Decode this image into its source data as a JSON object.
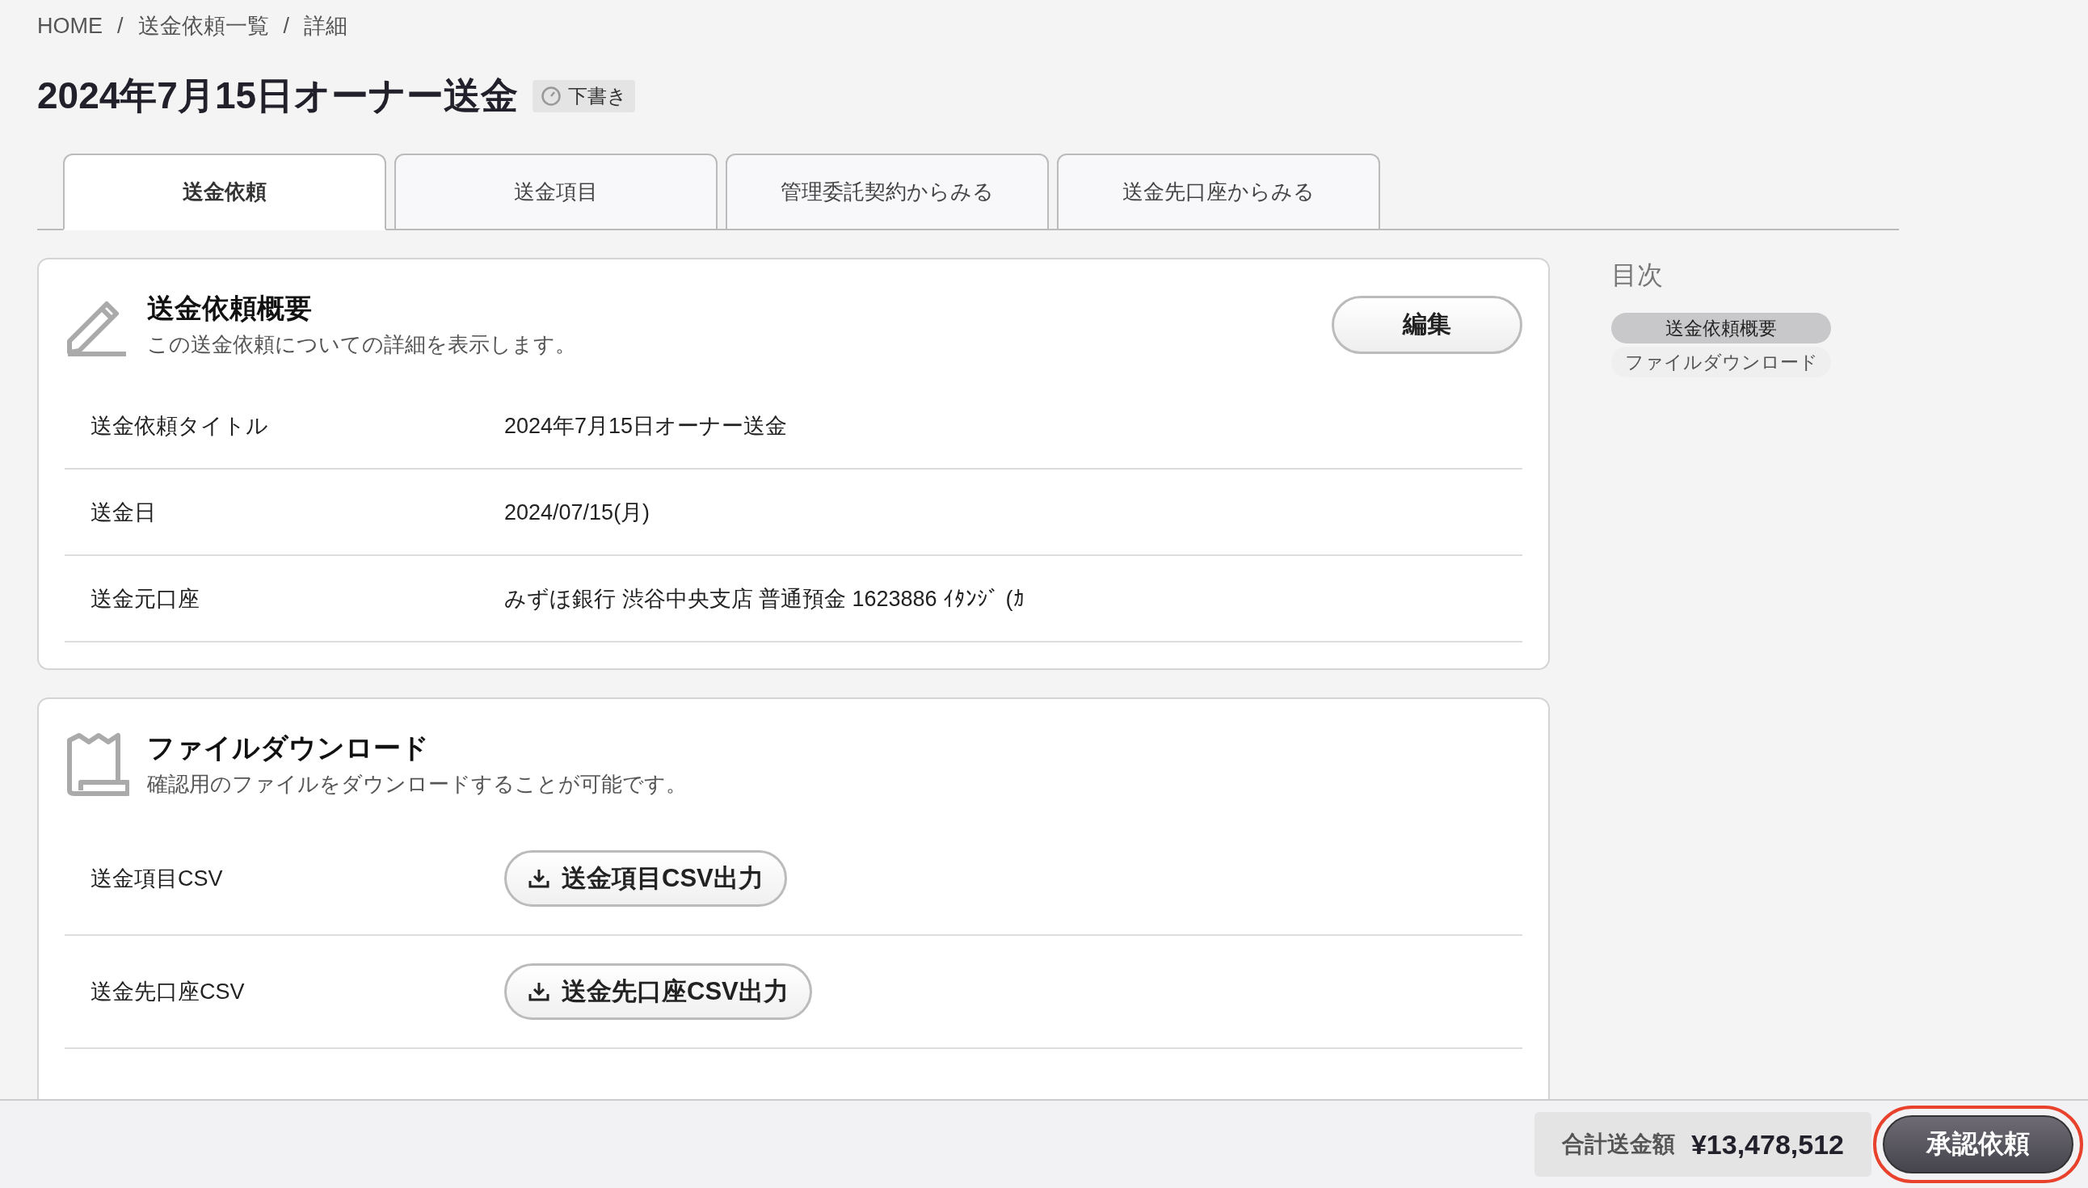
{
  "breadcrumb": {
    "separator": "/",
    "items": [
      "HOME",
      "送金依頼一覧",
      "詳細"
    ]
  },
  "title": "2024年7月15日オーナー送金",
  "status_badge": {
    "label": "下書き"
  },
  "tabs": [
    {
      "label": "送金依頼",
      "selected": true
    },
    {
      "label": "送金項目",
      "selected": false
    },
    {
      "label": "管理委託契約からみる",
      "selected": false
    },
    {
      "label": "送金先口座からみる",
      "selected": false
    }
  ],
  "sections": [
    {
      "kind": "details",
      "title": "送金依頼概要",
      "description": "この送金依頼についての詳細を表示します。",
      "action": "編集",
      "rows": [
        {
          "label": "送金依頼タイトル",
          "value": "2024年7月15日オーナー送金"
        },
        {
          "label": "送金日",
          "value": "2024/07/15(月)"
        },
        {
          "label": "送金元口座",
          "value": "みずほ銀行 渋谷中央支店 普通預金 1623886 ｲﾀﾝｼﾞ (ｶ"
        }
      ]
    },
    {
      "kind": "downloads",
      "title": "ファイルダウンロード",
      "description": "確認用のファイルをダウンロードすることが可能です。",
      "rows": [
        {
          "label": "送金項目CSV",
          "value": "送金項目CSV出力"
        },
        {
          "label": "送金先口座CSV",
          "value": "送金先口座CSV出力"
        }
      ]
    }
  ],
  "toc": {
    "title": "目次",
    "items": [
      {
        "label": "送金依頼概要",
        "selected": true
      },
      {
        "label": "ファイルダウンロード",
        "selected": false
      }
    ]
  },
  "footer": {
    "total_label": "合計送金額",
    "total_value": "¥13,478,512",
    "submit": {
      "label": "承認依頼",
      "highlighted": true
    }
  }
}
